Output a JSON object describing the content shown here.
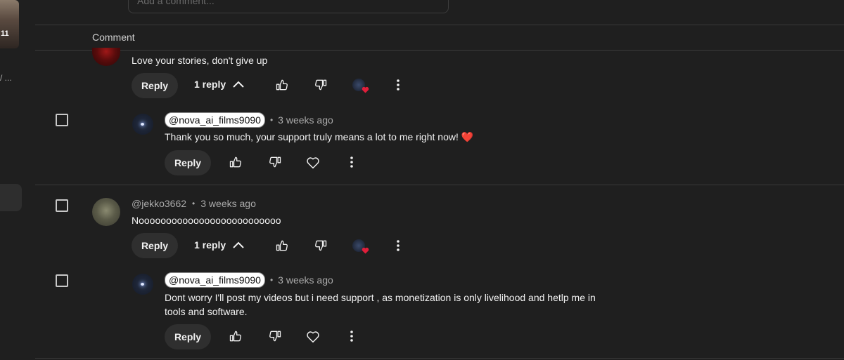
{
  "sidebar": {
    "thumbnail_number": "11",
    "ellipsis": "/ ..."
  },
  "composer": {
    "placeholder": "Add a comment..."
  },
  "header": {
    "label": "Comment"
  },
  "comments": [
    {
      "text": "Love your stories, don't give up",
      "reply_label": "Reply",
      "replies_label": "1 reply",
      "reply": {
        "author": "@nova_ai_films9090",
        "time": "3 weeks ago",
        "text": "Thank you so much, your support truly means a lot to me right now! ❤️",
        "reply_label": "Reply"
      }
    },
    {
      "author": "@jekko3662",
      "time": "3 weeks ago",
      "text": "Noooooooooooooooooooooooooo",
      "reply_label": "Reply",
      "replies_label": "1 reply",
      "reply": {
        "author": "@nova_ai_films9090",
        "time": "3 weeks ago",
        "text_line1": "Dont worry I'll post my videos but i need support , as monetization is only livelihood and hetlp me in",
        "text_line2": "tools and software.",
        "reply_label": "Reply"
      }
    }
  ],
  "colors": {
    "background": "#1f1f1f",
    "heart": "#e01e3a",
    "button": "#2f2f2f"
  }
}
